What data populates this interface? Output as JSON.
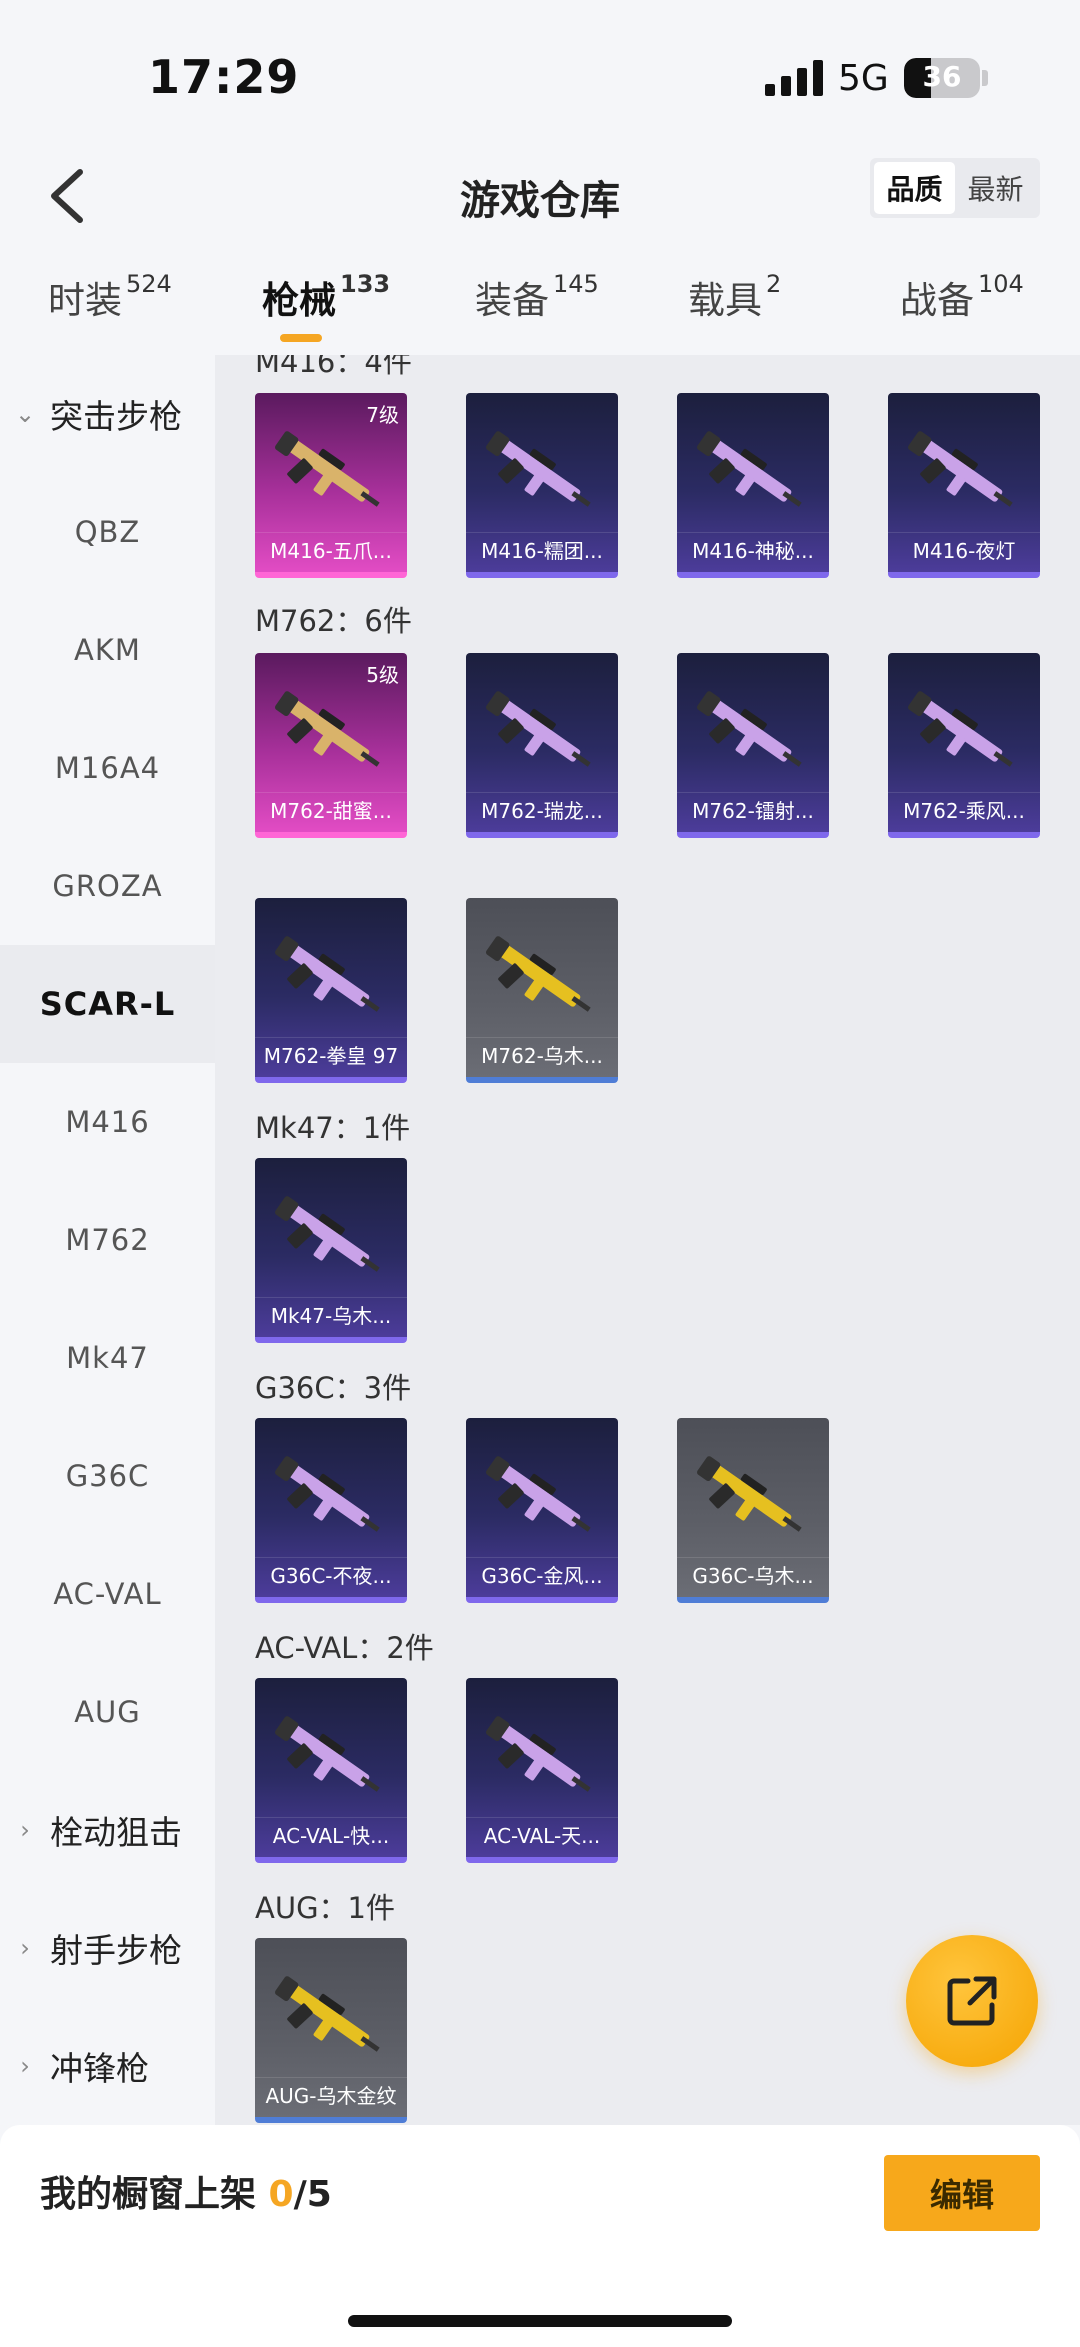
{
  "status_bar": {
    "time": "17:29",
    "network": "5G",
    "battery": "36",
    "battery_level": 0.36
  },
  "header": {
    "title": "游戏仓库",
    "sort_quality": "品质",
    "sort_newest": "最新"
  },
  "tabs": [
    {
      "label": "时装",
      "count": "524"
    },
    {
      "label": "枪械",
      "count": "133"
    },
    {
      "label": "装备",
      "count": "145"
    },
    {
      "label": "载具",
      "count": "2"
    },
    {
      "label": "战备",
      "count": "104"
    }
  ],
  "sidebar": {
    "group_assault": "突击步枪",
    "items": [
      "QBZ",
      "AKM",
      "M16A4",
      "GROZA",
      "SCAR-L",
      "M416",
      "M762",
      "Mk47",
      "G36C",
      "AC-VAL",
      "AUG"
    ],
    "group_bolt": "栓动狙击",
    "group_marksman": "射手步枪",
    "group_smg": "冲锋枪"
  },
  "sections": {
    "m416_partial": "M416：4件",
    "m762": "M762：6件",
    "mk47": "Mk47：1件",
    "g36c": "G36C：3件",
    "acval": "AC-VAL：2件",
    "aug": "AUG：1件"
  },
  "cards": {
    "m416": [
      {
        "name": "M416-五爪...",
        "level": "7级",
        "rarity": "pink"
      },
      {
        "name": "M416-糯团...",
        "rarity": "purple"
      },
      {
        "name": "M416-神秘...",
        "rarity": "purple"
      },
      {
        "name": "M416-夜灯",
        "rarity": "purple"
      }
    ],
    "m762": [
      {
        "name": "M762-甜蜜...",
        "level": "5级",
        "rarity": "pink"
      },
      {
        "name": "M762-瑞龙...",
        "rarity": "purple"
      },
      {
        "name": "M762-镭射...",
        "rarity": "purple"
      },
      {
        "name": "M762-乘风...",
        "rarity": "purple"
      },
      {
        "name": "M762-拳皇 97",
        "rarity": "purple"
      },
      {
        "name": "M762-乌木...",
        "rarity": "grey"
      }
    ],
    "mk47": [
      {
        "name": "Mk47-乌木...",
        "rarity": "purple"
      }
    ],
    "g36c": [
      {
        "name": "G36C-不夜...",
        "rarity": "purple"
      },
      {
        "name": "G36C-金风...",
        "rarity": "purple"
      },
      {
        "name": "G36C-乌木...",
        "rarity": "grey"
      }
    ],
    "acval": [
      {
        "name": "AC-VAL-快...",
        "rarity": "purple"
      },
      {
        "name": "AC-VAL-天...",
        "rarity": "purple"
      }
    ],
    "aug": [
      {
        "name": "AUG-乌木金纹",
        "rarity": "grey"
      }
    ]
  },
  "bottom": {
    "shelf_label": "我的橱窗上架 ",
    "shelf_count": "0",
    "shelf_total": "/5",
    "edit_label": "编辑"
  },
  "colors": {
    "accent": "#f5a623",
    "pink_rarity": "#e24cc4",
    "purple_rarity": "#7f68ec",
    "grey_rarity": "#5d5f67"
  }
}
